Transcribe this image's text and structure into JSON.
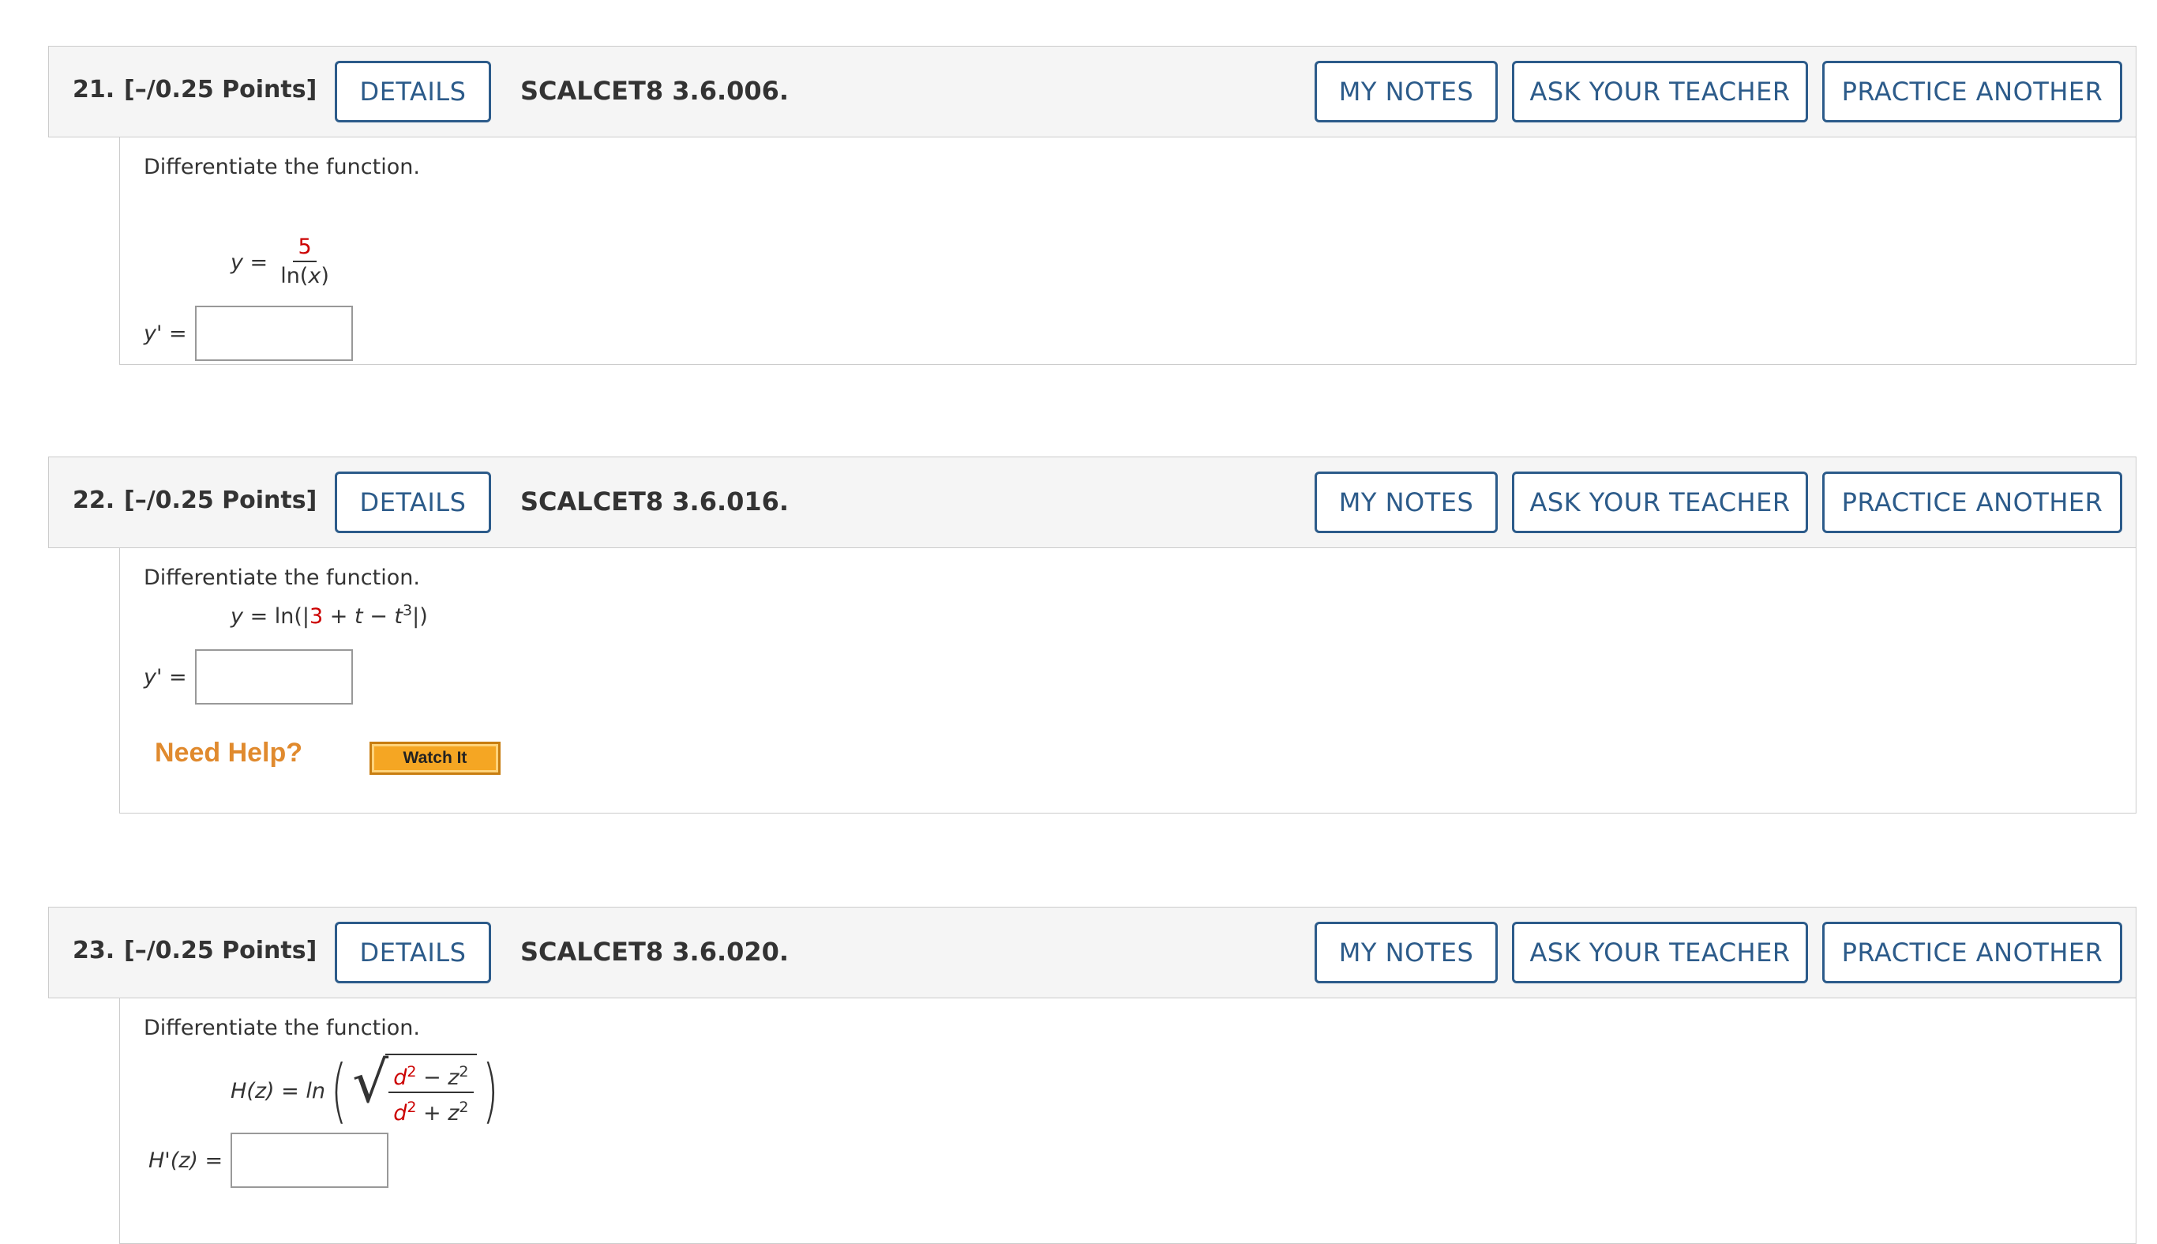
{
  "questions": [
    {
      "number": "21.",
      "points": "[–/0.25 Points]",
      "details_label": "DETAILS",
      "code": "SCALCET8 3.6.006.",
      "my_notes_label": "MY NOTES",
      "ask_teacher_label": "ASK YOUR TEACHER",
      "practice_label": "PRACTICE ANOTHER",
      "prompt": "Differentiate the function.",
      "function_lhs": "y =",
      "function_numerator": "5",
      "function_denominator_prefix": "ln(",
      "function_denominator_var": "x",
      "function_denominator_suffix": ")",
      "answer_label": "y' =",
      "answer_value": ""
    },
    {
      "number": "22.",
      "points": "[–/0.25 Points]",
      "details_label": "DETAILS",
      "code": "SCALCET8 3.6.016.",
      "my_notes_label": "MY NOTES",
      "ask_teacher_label": "ASK YOUR TEACHER",
      "practice_label": "PRACTICE ANOTHER",
      "prompt": "Differentiate the function.",
      "function_lhs": "y",
      "function_eq": " = ln(|",
      "function_const": "3",
      "function_mid": " + ",
      "function_t1": "t",
      "function_minus": " − ",
      "function_t2": "t",
      "function_exp": "3",
      "function_end": "|)",
      "answer_label": "y' =",
      "answer_value": "",
      "need_help_label": "Need Help?",
      "watch_it_label": "Watch It"
    },
    {
      "number": "23.",
      "points": "[–/0.25 Points]",
      "details_label": "DETAILS",
      "code": "SCALCET8 3.6.020.",
      "my_notes_label": "MY NOTES",
      "ask_teacher_label": "ASK YOUR TEACHER",
      "practice_label": "PRACTICE ANOTHER",
      "prompt": "Differentiate the function.",
      "function_lhs": "H(z) = ln",
      "num_d": "d",
      "num_d_exp": "2",
      "num_op": " − ",
      "num_z": "z",
      "num_z_exp": "2",
      "den_d": "d",
      "den_d_exp": "2",
      "den_op": " + ",
      "den_z": "z",
      "den_z_exp": "2",
      "answer_label": "H'(z) =",
      "answer_value": ""
    }
  ],
  "colors": {
    "accent": "#2c5b8a",
    "header_bg": "#f5f5f5",
    "red_value": "#cc0000",
    "need_help": "#e08a2e",
    "watch_btn": "#f5a623"
  }
}
